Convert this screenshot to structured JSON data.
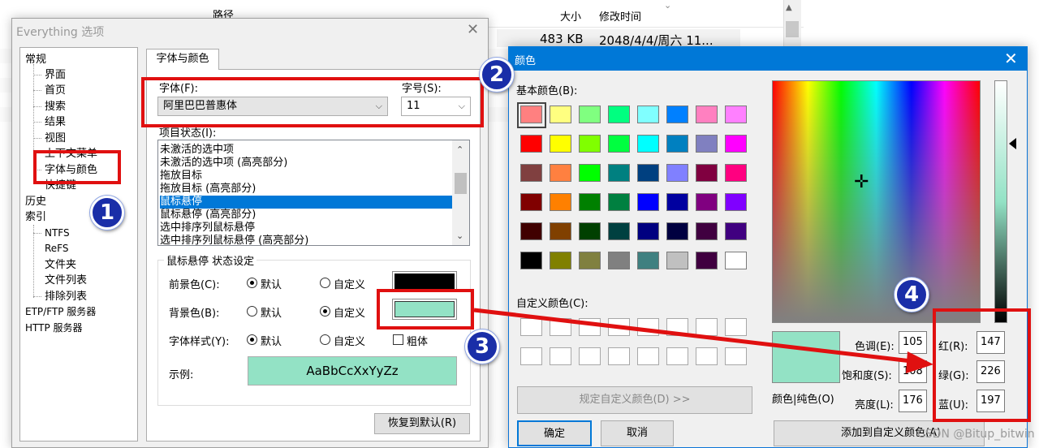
{
  "background": {
    "col_path": "路径",
    "col_size": "大小",
    "col_mtime": "修改时间",
    "row_size": "483 KB",
    "row_mtime": "2048/4/4/周六 11..."
  },
  "options_dialog": {
    "title": "Everything 选项",
    "close_glyph": "✕",
    "tree": {
      "general": "常规",
      "ui": "界面",
      "home": "首页",
      "search": "搜索",
      "results": "结果",
      "view": "视图",
      "context_menu": "上下文菜单",
      "font_color": "字体与颜色",
      "hotkeys": "快捷键",
      "history": "历史",
      "index": "索引",
      "ntfs": "NTFS",
      "refs": "ReFS",
      "folders": "文件夹",
      "file_lists": "文件列表",
      "exclude": "排除列表",
      "etp": "ETP/FTP 服务器",
      "http": "HTTP 服务器"
    },
    "tab_label": "字体与颜色",
    "font_label": "字体(F):",
    "font_value": "阿里巴巴普惠体",
    "size_label": "字号(S):",
    "size_value": "11",
    "state_label": "项目状态(I):",
    "states": [
      "未激活的选中项",
      "未激活的选中项 (高亮部分)",
      "拖放目标",
      "拖放目标 (高亮部分)",
      "鼠标悬停",
      "鼠标悬停 (高亮部分)",
      "选中排序列鼠标悬停",
      "选中排序列鼠标悬停 (高亮部分)"
    ],
    "selected_state_index": 4,
    "group_title": "鼠标悬停 状态设定",
    "fg_label": "前景色(C):",
    "bg_label": "背景色(B):",
    "style_label": "字体样式(Y):",
    "default_label": "默认",
    "custom_label": "自定义",
    "bold_label": "粗体",
    "sample_label": "示例:",
    "sample_text": "AaBbCcXxYyZz",
    "restore_button": "恢复到默认(R)",
    "fg_color": "#000000",
    "bg_color": "#93e2c5"
  },
  "color_dialog": {
    "title": "颜色",
    "close_glyph": "✕",
    "basic_label": "基本颜色(B):",
    "custom_label": "自定义颜色(C):",
    "define_button": "规定自定义颜色(D) >>",
    "ok_button": "确定",
    "cancel_button": "取消",
    "add_button": "添加到自定义颜色(A)",
    "solid_label": "颜色|纯色(O)",
    "hue_label": "色调(E):",
    "hue_value": "105",
    "sat_label": "饱和度(S):",
    "sat_value": "108",
    "lum_label": "亮度(L):",
    "lum_value": "176",
    "red_label": "红(R):",
    "red_value": "147",
    "green_label": "绿(G):",
    "green_value": "226",
    "blue_label": "蓝(U):",
    "blue_value": "197",
    "basic_colors": [
      "#ff8080",
      "#ffff80",
      "#80ff80",
      "#00ff80",
      "#80ffff",
      "#0080ff",
      "#ff80c0",
      "#ff80ff",
      "#ff0000",
      "#ffff00",
      "#80ff00",
      "#00ff40",
      "#00ffff",
      "#0080c0",
      "#8080c0",
      "#ff00ff",
      "#804040",
      "#ff8040",
      "#00ff00",
      "#008080",
      "#004080",
      "#8080ff",
      "#800040",
      "#ff0080",
      "#800000",
      "#ff8000",
      "#008000",
      "#008040",
      "#0000ff",
      "#0000a0",
      "#800080",
      "#8000ff",
      "#400000",
      "#804000",
      "#004000",
      "#004040",
      "#000080",
      "#000040",
      "#400040",
      "#400080",
      "#000000",
      "#808000",
      "#808040",
      "#808080",
      "#408080",
      "#c0c0c0",
      "#400040",
      "#ffffff"
    ]
  },
  "annotations": {
    "badge_1": "1",
    "badge_2": "2",
    "badge_3": "3",
    "badge_4": "4",
    "accent_red": "#e01010",
    "arrow_color": "#e01010"
  },
  "watermark": "CSDN @Bitup_bitwin"
}
